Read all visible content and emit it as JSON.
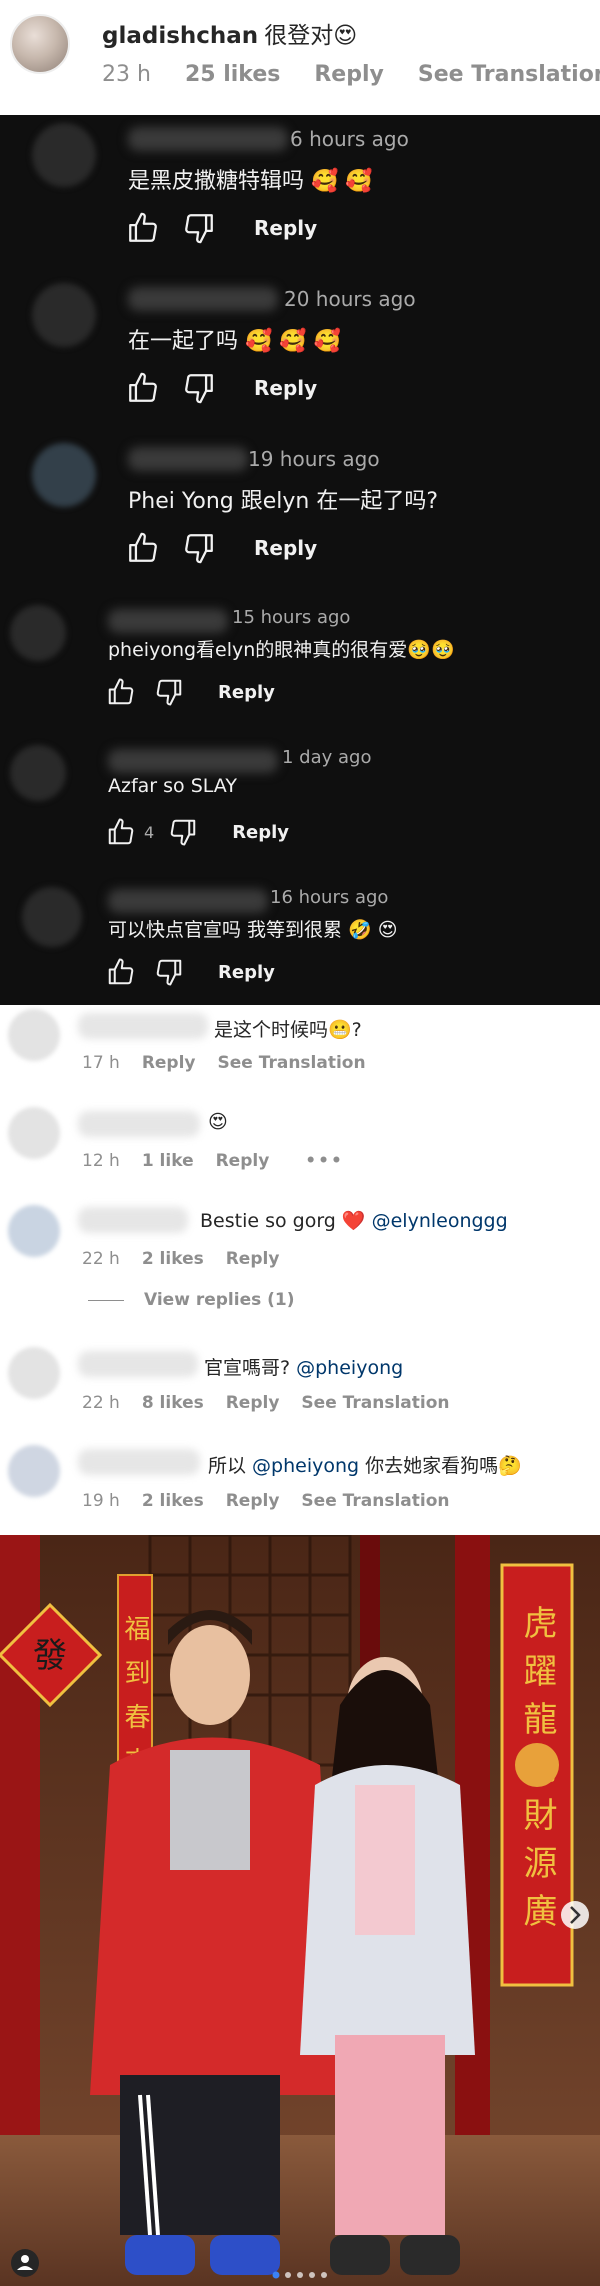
{
  "top_comment": {
    "username": "gladishchan",
    "text": "很登对😍",
    "time": "23 h",
    "likes": "25 likes",
    "reply": "Reply",
    "see_translation": "See Translation"
  },
  "yt_comments": [
    {
      "time": "6 hours ago",
      "text": "是黑皮撒糖特辑吗 🥰 🥰",
      "likes": "",
      "reply": "Reply"
    },
    {
      "time": "20 hours ago",
      "text": "在一起了吗 🥰 🥰 🥰",
      "likes": "",
      "reply": "Reply"
    },
    {
      "time": "19 hours ago",
      "text": "Phei Yong 跟elyn 在一起了吗?",
      "likes": "",
      "reply": "Reply"
    },
    {
      "time": "15 hours ago",
      "text": "pheiyong看elyn的眼神真的很有爱🥹🥹",
      "likes": "",
      "reply": "Reply"
    },
    {
      "time": "1 day ago",
      "text": "Azfar so SLAY",
      "likes": "4",
      "reply": "Reply"
    },
    {
      "time": "16 hours ago",
      "text": "可以快点官宣吗 我等到很累 🤣 😍",
      "likes": "",
      "reply": "Reply"
    }
  ],
  "ig_comments": [
    {
      "text": "是这个时候吗😬?",
      "mention": "",
      "after": "",
      "time": "17 h",
      "likes": "",
      "reply": "Reply",
      "see_translation": "See Translation",
      "more": ""
    },
    {
      "text": "😍",
      "mention": "",
      "after": "",
      "time": "12 h",
      "likes": "1 like",
      "reply": "Reply",
      "see_translation": "",
      "more": "•••"
    },
    {
      "text": "Bestie so gorg ❤️ ",
      "mention": "@elynleonggg",
      "after": "",
      "time": "22 h",
      "likes": "2 likes",
      "reply": "Reply",
      "see_translation": "",
      "more": ""
    },
    {
      "text": "官宣嗎哥? ",
      "mention": "@pheiyong",
      "after": "",
      "time": "22 h",
      "likes": "8 likes",
      "reply": "Reply",
      "see_translation": "See Translation",
      "more": ""
    },
    {
      "text": "所以 ",
      "mention": "@pheiyong",
      "after": " 你去她家看狗嗎🤔",
      "time": "19 h",
      "likes": "2 likes",
      "reply": "Reply",
      "see_translation": "See Translation",
      "more": ""
    }
  ],
  "view_replies": "View replies (1)",
  "photo": {
    "couplet_char": "發",
    "right_banner": "虎躍龍騰財源廣",
    "left_banner": "福到春來"
  },
  "colors": {
    "yt_bg": "#0f0f0f",
    "ig_text": "#262626",
    "ig_meta": "#8e8e8e",
    "mention": "#00376b",
    "jacket_red": "#d42a2a"
  }
}
